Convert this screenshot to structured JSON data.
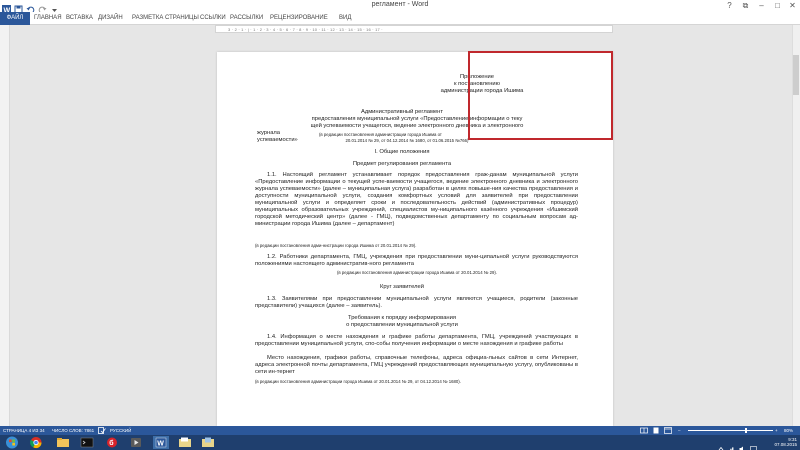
{
  "window": {
    "title": "регламент - Word",
    "controls": {
      "help": "?",
      "restore": "⧉",
      "minimize": "–",
      "maximize": "□",
      "close": "✕"
    }
  },
  "ribbon": {
    "file": "ФАЙЛ",
    "tabs": [
      "ГЛАВНАЯ",
      "ВСТАВКА",
      "ДИЗАЙН",
      "РАЗМЕТКА СТРАНИЦЫ",
      "ССЫЛКИ",
      "РАССЫЛКИ",
      "РЕЦЕНЗИРОВАНИЕ",
      "ВИД"
    ]
  },
  "ruler": {
    "marks": "3 · 2 · 1 · | · 1 · 2 · 3 · 4 · 5 · 6 · 7 · 8 · 9 · 10 · 11 · 12 · 13 · 14 · 15 · 16 · 17 ·"
  },
  "document": {
    "appendix": [
      "Приложение",
      "к постановлению",
      "администрации города Ишима"
    ],
    "title_lines": [
      "Административный регламент",
      "предоставления муниципальной услуги «Предоставление информации о теку",
      "щей успеваемости учащегося, ведение электронного дневника и электронного",
      "журнала успеваемости»"
    ],
    "title_edition_small": "(в редакции постановления администрации города Ишима от",
    "title_edition_small_2": "20.01.2014 № 29, от 04.12.2014 № 1680, от 01.06.2015 №766)",
    "section1": "I.     Общие положения",
    "subtitle1": "Предмет регулирования регламента",
    "para1": "1.1. Настоящий регламент устанавливает порядок предоставления граж-данам муниципальной услуги «Предоставление информации о текущей успе-ваемости учащегося, ведение электронного дневника и электронного журнала успеваемости» (далее – муниципальная услуга) разработан в целях повыше-ния качества предоставления и доступности муниципальной услуги, создания комфортных условий для заявителей при предоставлении муниципальной услуги и определяет сроки и последовательность действий (административных процедур) муниципальных образовательных учреждений, специалистов му-ниципального казённого учреждения «Ишимский городской методический центр» (далее - ГМЦ), подведомственных департаменту по социальным вопросам ад-министрации города Ишима  (далее – департамент)",
    "para1_small": "(в редакции постановления адми-нистрации города Ишима от 20.01.2014 № 29).",
    "para2": "1.2. Работники департамента, ГМЦ, учреждения при предоставлении муни-ципальной услуги руководствуются положениями настоящего административ-ного регламента",
    "para2_small": "(в редакции постановления администрации города Ишима от 20.01.2014 № 29).",
    "subtitle2": "Круг заявителей",
    "para3": "1.3. Заявителями при предоставлении муниципальной услуги являются учащиеся, родители (законные представители) учащихся (далее – заявитель).",
    "subtitle3_a": "Требования к порядку информирования",
    "subtitle3_b": "о предоставлении муниципальной услуги",
    "para4": "1.4. Информация о месте нахождения и графике работы департамента, ГМЦ, учреждений участвующих в предоставлении муниципальной услуги, спо-собы получения информации о месте нахождения и графике работы",
    "para5": "Место нахождения, графики работы, справочные телефоны, адреса официа-льных сайтов в сети Интернет, адреса электронной почты департамента, ГМЦ учреждений предоставляющих муниципальную услугу, опубликованы в сети ин-тернет",
    "para5_small": "(в редакции постановления администрации города Ишима от 20.01.2014 № 29, от 04.12.2014 № 1680)."
  },
  "status": {
    "page": "СТРАНИЦА 4 ИЗ 34",
    "words": "ЧИСЛО СЛОВ: 7861",
    "lang": "РУССКИЙ",
    "zoom": "80%"
  },
  "taskbar": {
    "time": "9:31",
    "date": "07.08.2015"
  },
  "colors": {
    "accent": "#2b579a",
    "annotation": "#c0282d",
    "taskbar": "#1f3f6e"
  }
}
